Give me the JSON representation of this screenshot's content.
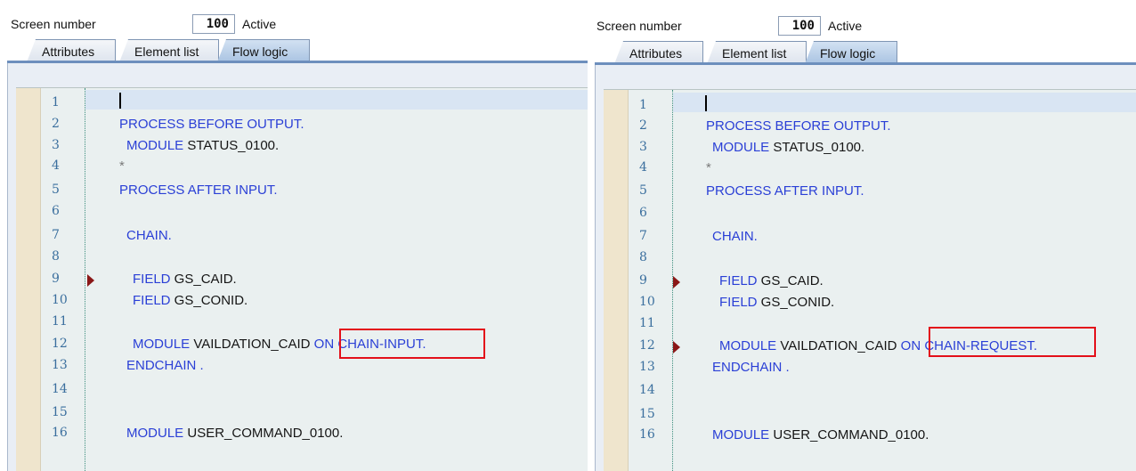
{
  "panels": [
    {
      "screen_number_label": "Screen number",
      "screen_number_value": "100",
      "status": "Active",
      "tabs": [
        "Attributes",
        "Element list",
        "Flow logic"
      ],
      "active_tab": "Flow logic",
      "line_numbers": [
        "1",
        "2",
        "3",
        "4",
        "5",
        "6",
        "7",
        "8",
        "9",
        "10",
        "11",
        "12",
        "13",
        "14",
        "15",
        "16"
      ],
      "code": {
        "l2": "PROCESS BEFORE OUTPUT.",
        "l3_kw": "MODULE",
        "l3_id": " STATUS_0100.",
        "l4": "*",
        "l5": "PROCESS AFTER INPUT.",
        "l7": "CHAIN.",
        "l9_kw": "FIELD",
        "l9_id": " GS_CAID.",
        "l10_kw": "FIELD",
        "l10_id": " GS_CONID.",
        "l12_kw": "MODULE",
        "l12_id": " VAILDATION_CAID ",
        "l12_tail": "ON CHAIN-INPUT.",
        "l13": "ENDCHAIN .",
        "l16_kw": "MODULE",
        "l16_id": " USER_COMMAND_0100."
      }
    },
    {
      "screen_number_label": "Screen number",
      "screen_number_value": "100",
      "status": "Active",
      "tabs": [
        "Attributes",
        "Element list",
        "Flow logic"
      ],
      "active_tab": "Flow logic",
      "line_numbers": [
        "1",
        "2",
        "3",
        "4",
        "5",
        "6",
        "7",
        "8",
        "9",
        "10",
        "11",
        "12",
        "13",
        "14",
        "15",
        "16"
      ],
      "code": {
        "l2": "PROCESS BEFORE OUTPUT.",
        "l3_kw": "MODULE",
        "l3_id": " STATUS_0100.",
        "l4": "*",
        "l5": "PROCESS AFTER INPUT.",
        "l7": "CHAIN.",
        "l9_kw": "FIELD",
        "l9_id": " GS_CAID.",
        "l10_kw": "FIELD",
        "l10_id": " GS_CONID.",
        "l12_kw": "MODULE",
        "l12_id": " VAILDATION_CAID ",
        "l12_tail": "ON CHAIN-REQUEST.",
        "l13": "ENDCHAIN .",
        "l16_kw": "MODULE",
        "l16_id": " USER_COMMAND_0100."
      }
    }
  ],
  "colors": {
    "keyword": "#2a3fd6",
    "identifier": "#151515",
    "line_number": "#3b6f9e",
    "breakpoint_marker": "#8a1717",
    "annotation_box": "#e3101a"
  }
}
